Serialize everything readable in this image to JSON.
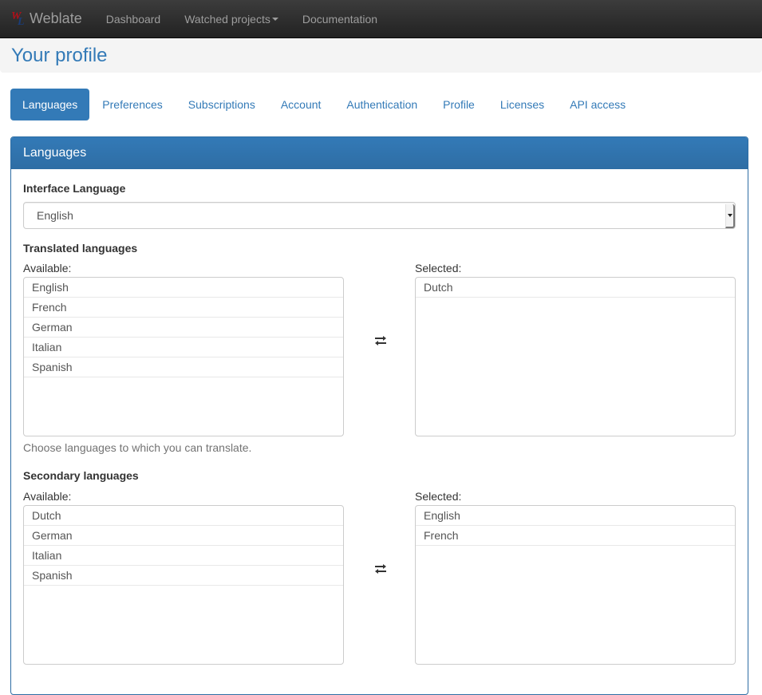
{
  "navbar": {
    "brand": "Weblate",
    "logo_letters": [
      "W",
      "L"
    ],
    "items": [
      {
        "label": "Dashboard",
        "has_caret": false
      },
      {
        "label": "Watched projects",
        "has_caret": true
      },
      {
        "label": "Documentation",
        "has_caret": false
      }
    ]
  },
  "page": {
    "title": "Your profile"
  },
  "tabs": [
    {
      "label": "Languages",
      "active": true
    },
    {
      "label": "Preferences",
      "active": false
    },
    {
      "label": "Subscriptions",
      "active": false
    },
    {
      "label": "Account",
      "active": false
    },
    {
      "label": "Authentication",
      "active": false
    },
    {
      "label": "Profile",
      "active": false
    },
    {
      "label": "Licenses",
      "active": false
    },
    {
      "label": "API access",
      "active": false
    }
  ],
  "panel": {
    "heading": "Languages",
    "interface_language": {
      "label": "Interface Language",
      "value": "English"
    },
    "translated_languages": {
      "label": "Translated languages",
      "available_label": "Available:",
      "selected_label": "Selected:",
      "available": [
        "English",
        "French",
        "German",
        "Italian",
        "Spanish"
      ],
      "selected": [
        "Dutch"
      ],
      "help": "Choose languages to which you can translate."
    },
    "secondary_languages": {
      "label": "Secondary languages",
      "available_label": "Available:",
      "selected_label": "Selected:",
      "available": [
        "Dutch",
        "German",
        "Italian",
        "Spanish"
      ],
      "selected": [
        "English",
        "French"
      ]
    }
  },
  "colors": {
    "primary": "#337ab7",
    "navbar_bg": "#222222",
    "navbar_text": "#9d9d9d"
  }
}
